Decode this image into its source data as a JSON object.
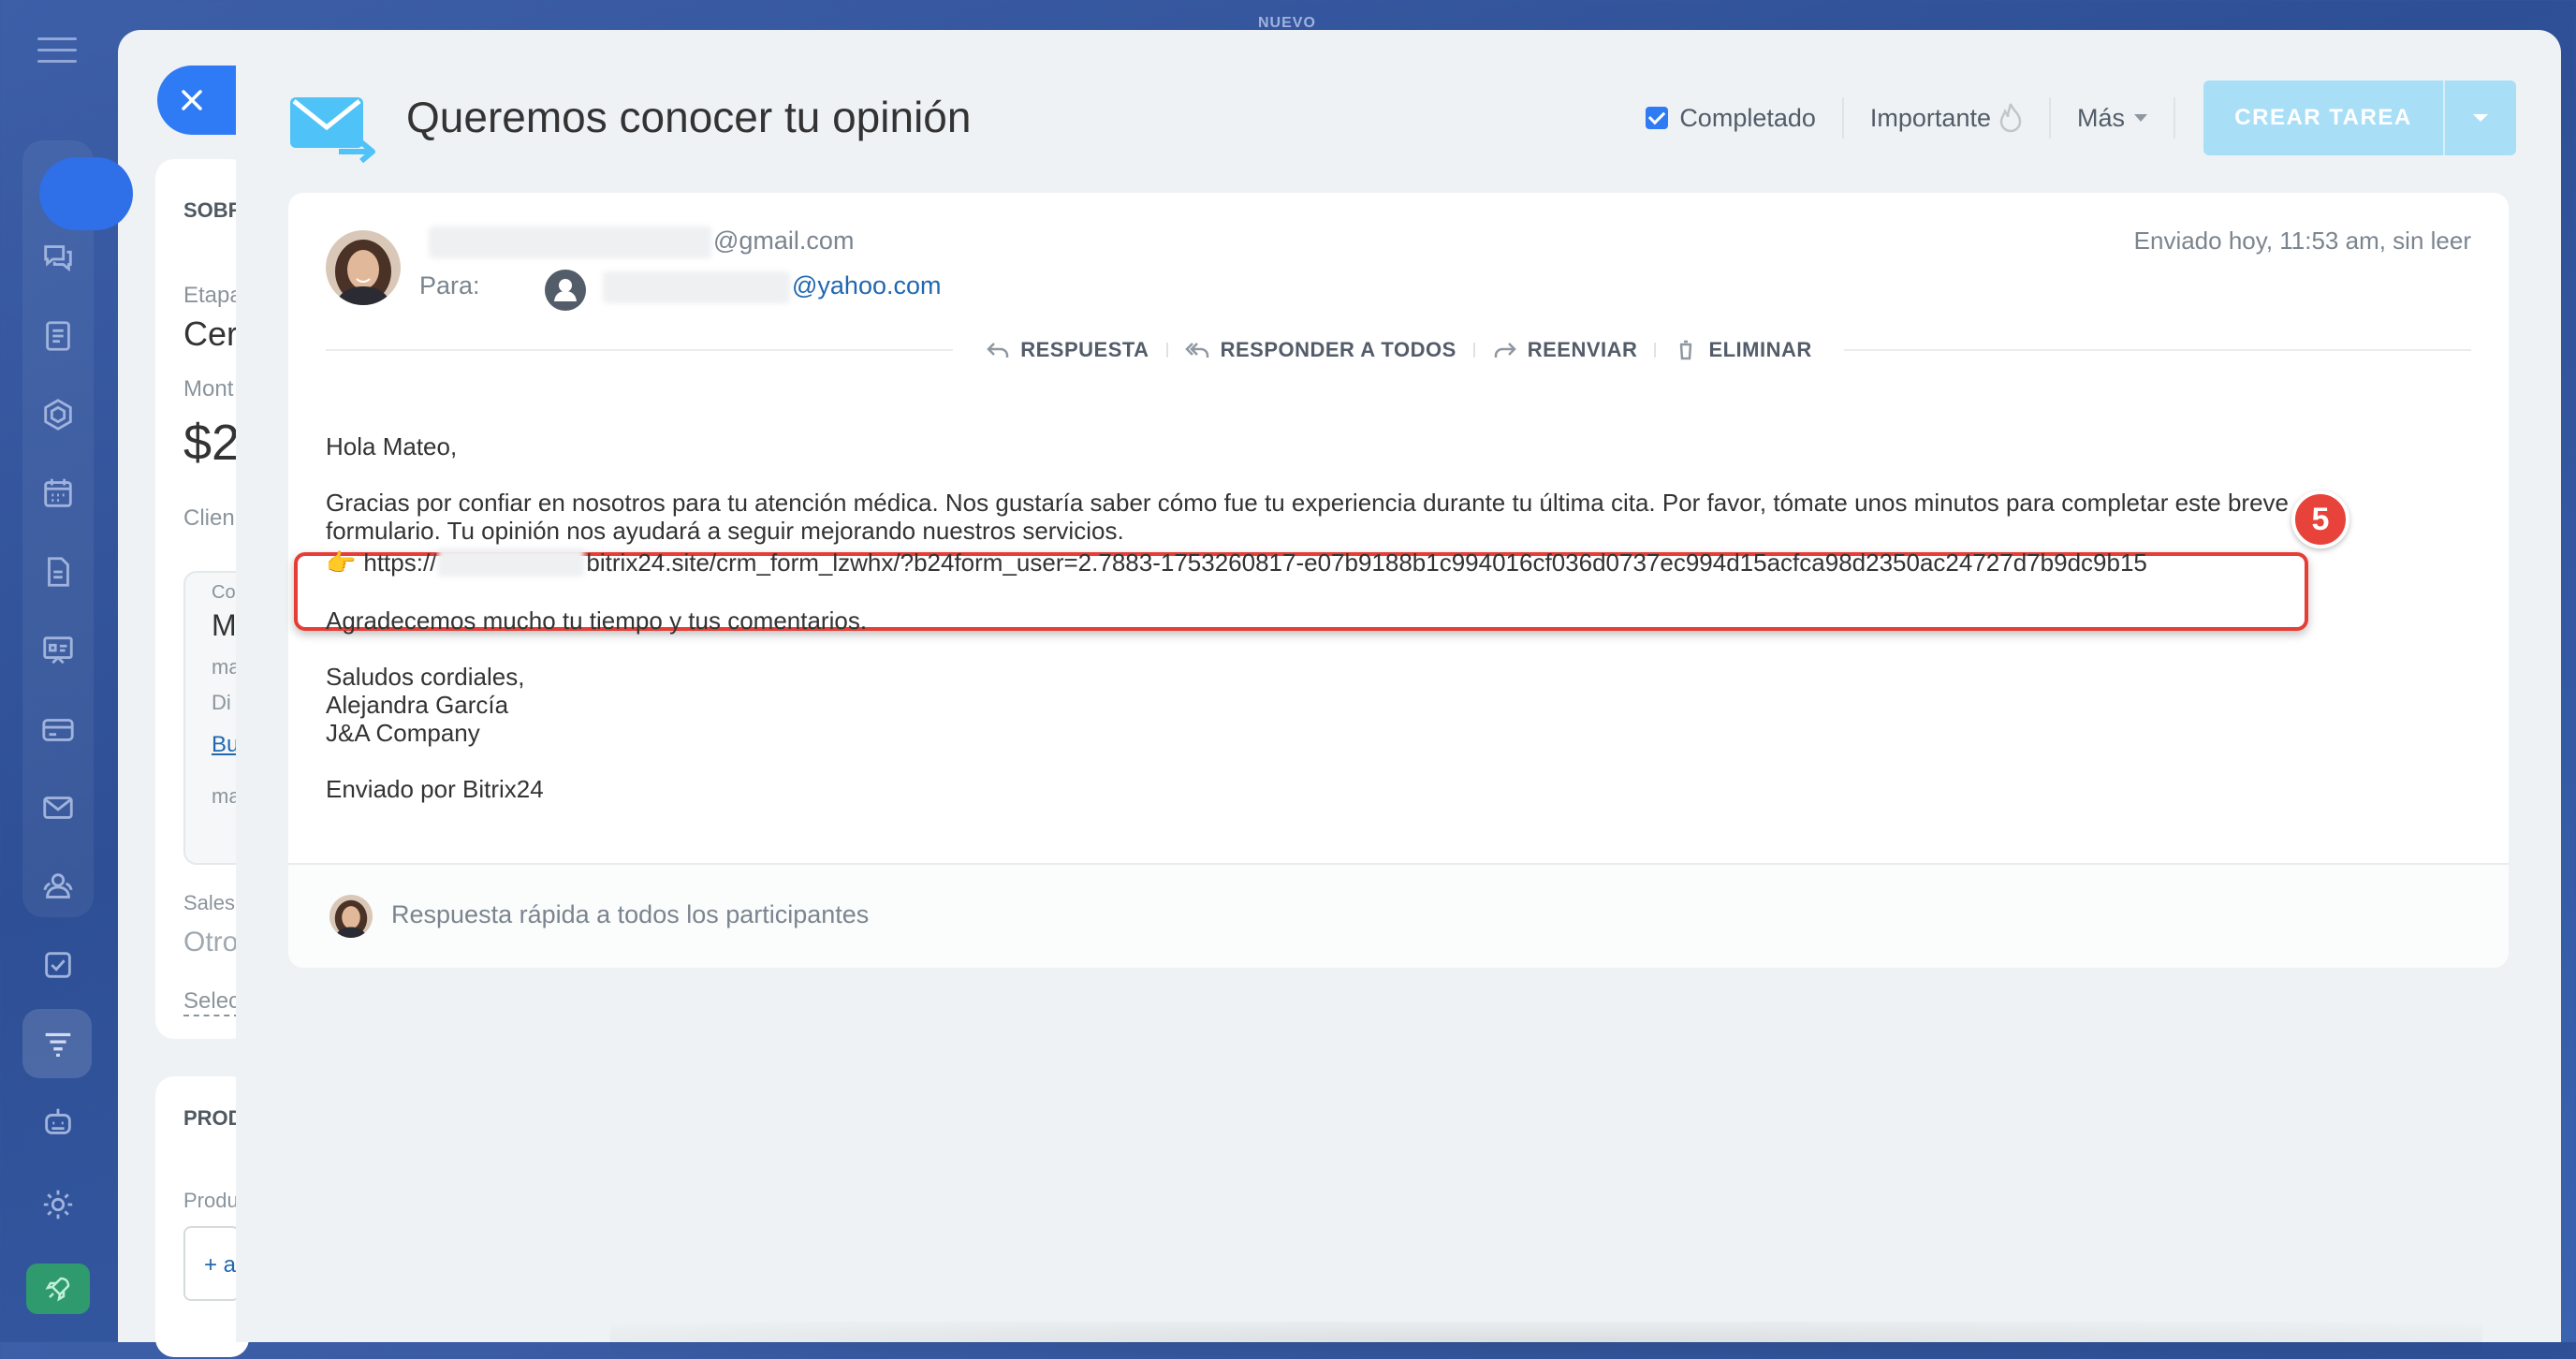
{
  "background": {
    "top_label": "NUEVO",
    "crm": {
      "section_about": "SOBR",
      "stage_label": "Etapa",
      "stage_value": "Cerr",
      "amount_label": "Mont",
      "amount_value": "$2",
      "client_label": "Clien",
      "contact_label": "Co",
      "contact_name": "M",
      "contact_line1": "ma",
      "contact_line2": "Di",
      "contact_link": "Bu",
      "contact_line3": "ma",
      "sales_label": "Sales",
      "sales_value": "Otro",
      "select_link": "Selec",
      "section_products": "PROD",
      "product_label": "Produ",
      "add_product": "+ a"
    }
  },
  "sidebar": {
    "items": [
      {
        "icon": "chat-icon"
      },
      {
        "icon": "document-icon"
      },
      {
        "icon": "hexagon-icon"
      },
      {
        "icon": "calendar-icon"
      },
      {
        "icon": "file-icon"
      },
      {
        "icon": "presentation-icon"
      },
      {
        "icon": "card-icon"
      },
      {
        "icon": "mail-icon"
      },
      {
        "icon": "users-icon"
      },
      {
        "icon": "checkbox-icon"
      },
      {
        "icon": "funnel-icon"
      },
      {
        "icon": "robot-icon"
      },
      {
        "icon": "gear-icon"
      }
    ]
  },
  "header": {
    "title": "Queremos conocer tu opinión",
    "completed_label": "Completado",
    "important_label": "Importante",
    "more_label": "Más",
    "create_task_label": "CREAR TAREA"
  },
  "email": {
    "from_domain": "@gmail.com",
    "to_label": "Para:",
    "to_domain": "@yahoo.com",
    "sent_info": "Enviado hoy, 11:53 am, sin leer",
    "actions": {
      "reply": "RESPUESTA",
      "reply_all": "RESPONDER A TODOS",
      "forward": "REENVIAR",
      "delete": "ELIMINAR"
    },
    "greeting": "Hola Mateo,",
    "paragraph1_line1": "Gracias por confiar en nosotros para tu atención médica. Nos gustaría saber cómo fue tu experiencia durante tu última cita. Por favor, tómate unos minutos para completar este breve",
    "paragraph1_line2": "formulario. Tu opinión nos ayudará a seguir mejorando nuestros servicios.",
    "link_emoji": "👉",
    "link_prefix": "https://",
    "link_suffix": "bitrix24.site/crm_form_lzwhx/?b24form_user=2.7883-1753260817-e07b9188b1c994016cf036d0737ec994d15acfca98d2350ac24727d7b9dc9b15",
    "step_badge": "5",
    "thanks": "Agradecemos mucho tu tiempo y tus comentarios.",
    "closing": "Saludos cordiales,",
    "sender_name": "Alejandra García",
    "company": "J&A Company",
    "footer": "Enviado por Bitrix24",
    "quick_reply_placeholder": "Respuesta rápida a todos los participantes"
  },
  "colors": {
    "accent": "#2f7bf5",
    "create_button": "#a8dff7",
    "highlight": "#e53e36",
    "link": "#2067b0"
  }
}
